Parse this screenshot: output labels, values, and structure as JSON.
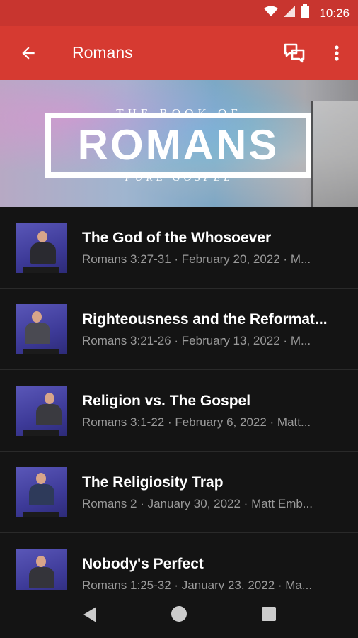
{
  "status_bar": {
    "time": "10:26"
  },
  "app_bar": {
    "title": "Romans"
  },
  "banner": {
    "top_text": "THE BOOK OF",
    "main_text": "ROMANS",
    "sub_text": "PURE GOSPEL"
  },
  "sermons": [
    {
      "title": "The God of the Whosoever",
      "subtitle": "Romans 3:27-31 · February 20, 2022 · M..."
    },
    {
      "title": "Righteousness and the Reformat...",
      "subtitle": "Romans 3:21-26 · February 13, 2022 · M..."
    },
    {
      "title": "Religion vs. The Gospel",
      "subtitle": "Romans 3:1-22 · February 6, 2022 · Matt..."
    },
    {
      "title": "The Religiosity Trap",
      "subtitle": "Romans 2 · January 30, 2022 · Matt Emb..."
    },
    {
      "title": "Nobody's Perfect",
      "subtitle": "Romans 1:25-32 · January 23, 2022 · Ma..."
    }
  ],
  "colors": {
    "status_bar": "#c8352f",
    "app_bar": "#d63a31",
    "background": "#141414",
    "subtitle_text": "#9a9a9a",
    "thumbnail_background": "#3d3a98"
  },
  "icons": {
    "status": [
      "wifi-icon",
      "cell-signal-icon",
      "battery-icon"
    ],
    "app_bar": [
      "back-arrow-icon",
      "chat-icon",
      "more-vert-icon"
    ],
    "nav": [
      "nav-back-icon",
      "nav-home-icon",
      "nav-recents-icon"
    ]
  }
}
